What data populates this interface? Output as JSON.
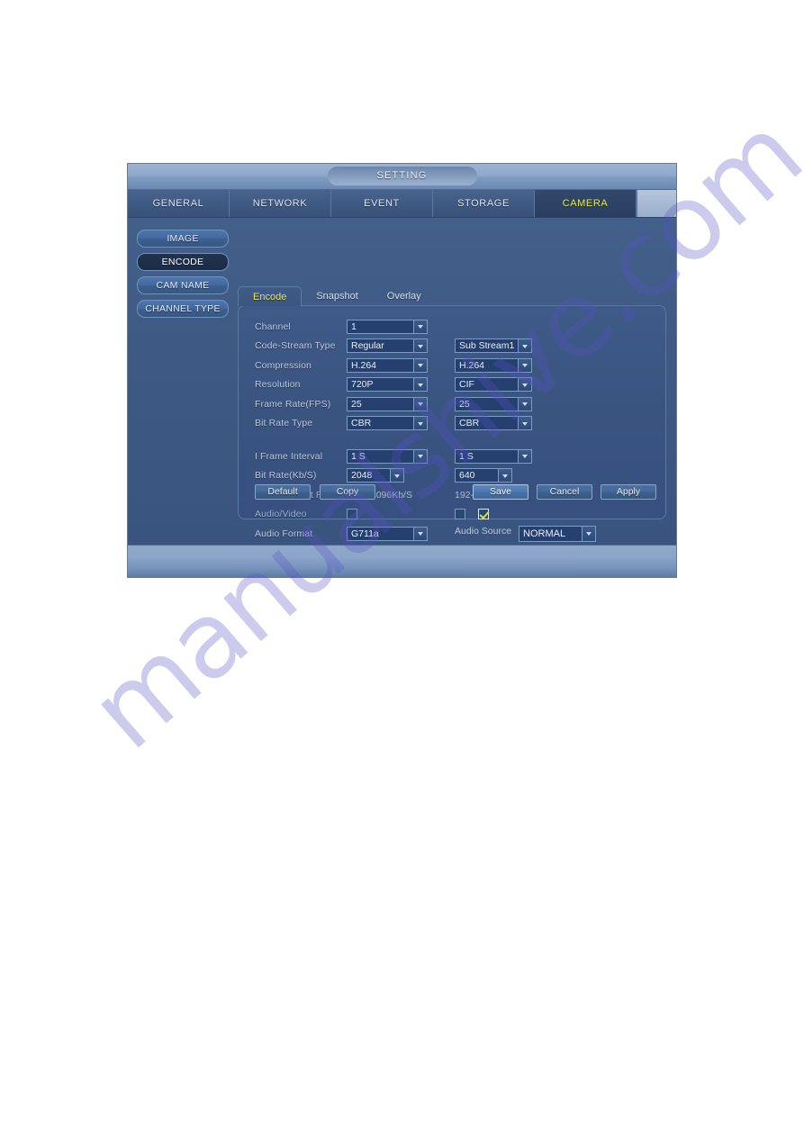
{
  "window": {
    "title": "SETTING"
  },
  "main_tabs": [
    {
      "label": "GENERAL",
      "active": false
    },
    {
      "label": "NETWORK",
      "active": false
    },
    {
      "label": "EVENT",
      "active": false
    },
    {
      "label": "STORAGE",
      "active": false
    },
    {
      "label": "CAMERA",
      "active": true
    }
  ],
  "sidebar": {
    "items": [
      {
        "label": "IMAGE",
        "active": false
      },
      {
        "label": "ENCODE",
        "active": true
      },
      {
        "label": "CAM NAME",
        "active": false
      },
      {
        "label": "CHANNEL TYPE",
        "active": false
      }
    ]
  },
  "sub_tabs": [
    {
      "label": "Encode",
      "active": true
    },
    {
      "label": "Snapshot",
      "active": false
    },
    {
      "label": "Overlay",
      "active": false
    }
  ],
  "form": {
    "channel": {
      "label": "Channel",
      "main": "1"
    },
    "code_stream_type": {
      "label": "Code-Stream Type",
      "main": "Regular",
      "sub": "Sub Stream1"
    },
    "compression": {
      "label": "Compression",
      "main": "H.264",
      "sub": "H.264"
    },
    "resolution": {
      "label": "Resolution",
      "main": "720P",
      "sub": "CIF"
    },
    "frame_rate": {
      "label": "Frame Rate(FPS)",
      "main": "25",
      "sub": "25"
    },
    "bit_rate_type": {
      "label": "Bit Rate Type",
      "main": "CBR",
      "sub": "CBR"
    },
    "i_frame_interval": {
      "label": "I Frame Interval",
      "main": "1 S",
      "sub": "1 S"
    },
    "bit_rate": {
      "label": "Bit Rate(Kb/S)",
      "main": "2048",
      "sub": "640"
    },
    "reference_bit_rate": {
      "label": "Reference Bit Rate",
      "main": "1536-4096Kb/S",
      "sub": "192-1024Kb/S"
    },
    "audio_video": {
      "label": "Audio/Video",
      "main_checked": false,
      "sub_checked": false,
      "sub_audio_checked": true
    },
    "audio_format": {
      "label": "Audio Format",
      "main": "G711a"
    },
    "audio_source": {
      "label": "Audio Source",
      "value": "NORMAL"
    }
  },
  "buttons": {
    "default": "Default",
    "copy": "Copy",
    "save": "Save",
    "cancel": "Cancel",
    "apply": "Apply"
  },
  "watermark": {
    "text": "manualshive.com"
  },
  "colors": {
    "accent_yellow": "#ecec45",
    "panel_blue": "#3a5480",
    "field_blue": "#25406e",
    "check_green": "#d7e04a"
  }
}
